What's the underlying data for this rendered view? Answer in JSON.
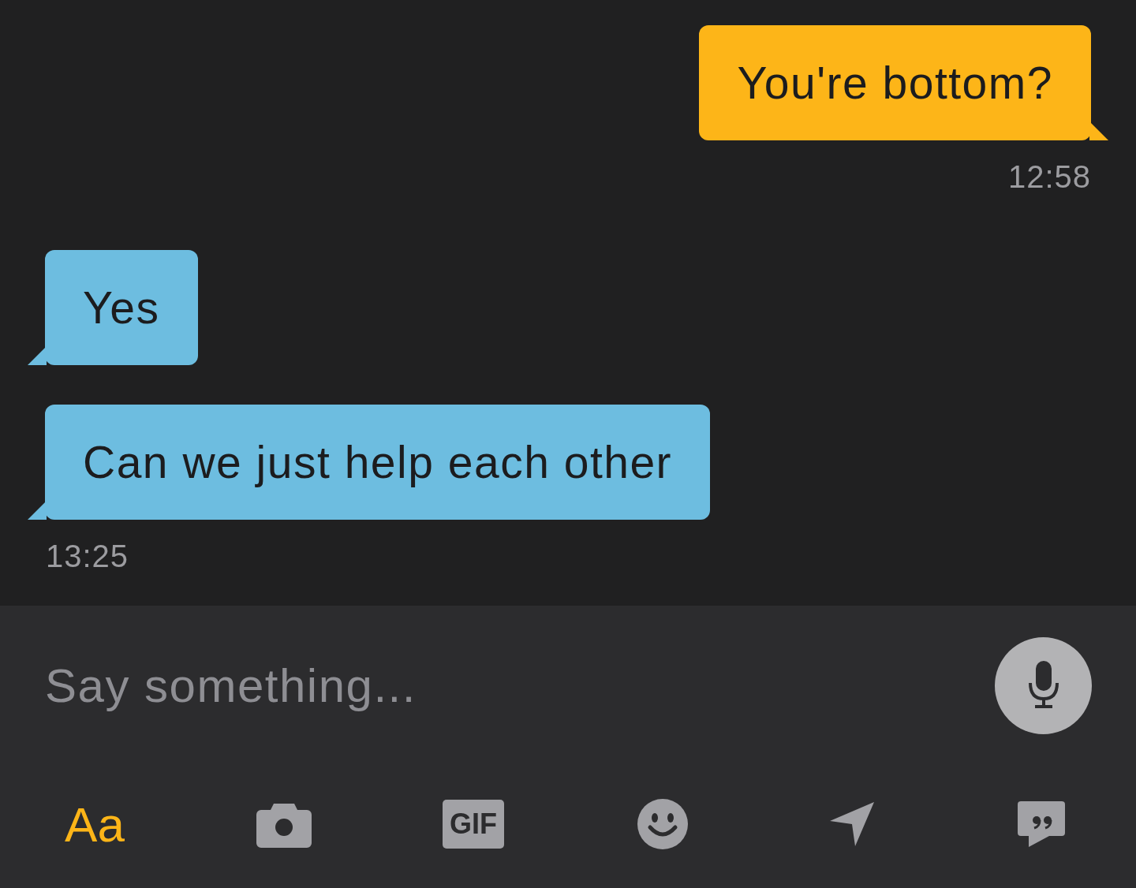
{
  "messages": [
    {
      "kind": "outgoing",
      "text": "You're bottom?",
      "time": "12:58"
    },
    {
      "kind": "incoming",
      "text": "Yes"
    },
    {
      "kind": "incoming",
      "text": "Can we just help each other",
      "time": "13:25"
    }
  ],
  "composer": {
    "placeholder": "Say something..."
  },
  "toolbar": [
    {
      "kind": "text",
      "label": "Aa",
      "selected": true
    },
    {
      "kind": "camera",
      "selected": false
    },
    {
      "kind": "gif",
      "label": "GIF",
      "selected": false
    },
    {
      "kind": "emoji",
      "selected": false
    },
    {
      "kind": "location",
      "selected": false
    },
    {
      "kind": "quote",
      "selected": false
    }
  ]
}
